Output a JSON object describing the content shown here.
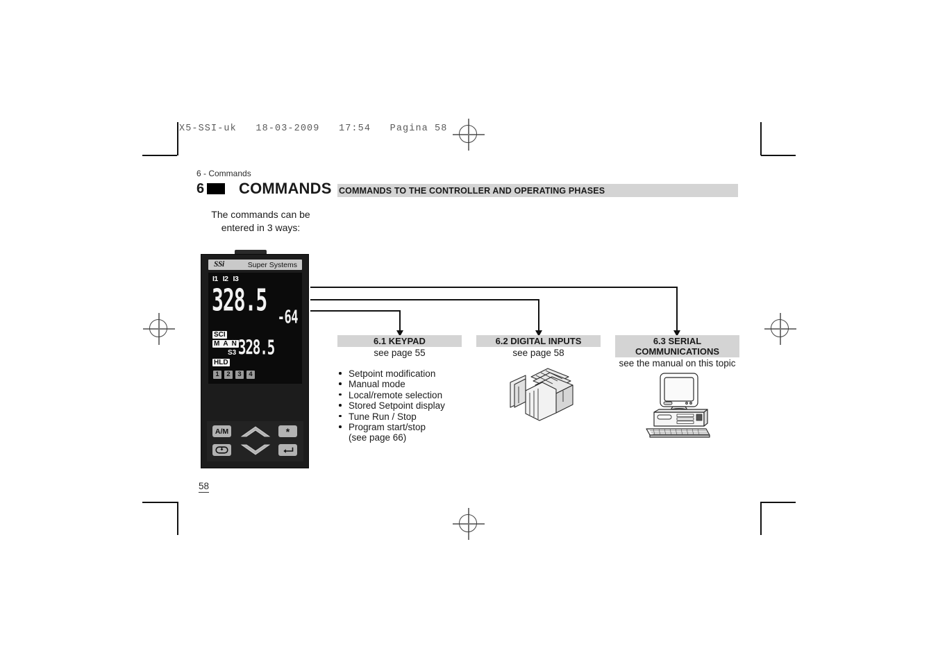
{
  "print_marks": {
    "file_banner": "X5-SSI-uk   18-03-2009   17:54   Pagina 58"
  },
  "header": {
    "running_head": "6 - Commands",
    "chapter_number": "6",
    "chapter_title": "COMMANDS",
    "banner_text": "COMMANDS TO THE CONTROLLER AND OPERATING PHASES"
  },
  "intro": {
    "text": "The commands can be entered in 3 ways:"
  },
  "device": {
    "brand_logo": "SSi",
    "brand_name": "Super Systems",
    "input_indicators": [
      "I1",
      "I2",
      "I3"
    ],
    "process_value": "328.5",
    "setpoint_value": "-64",
    "output_value": "328.5",
    "status_tags": {
      "sci": "SCI",
      "man": "M A N",
      "s3": "S3",
      "hld": "HLD"
    },
    "program_segments": [
      "1",
      "2",
      "3",
      "4"
    ],
    "keys": [
      {
        "name": "auto-manual-key",
        "label": "A/M"
      },
      {
        "name": "up-arrow-key",
        "label": ""
      },
      {
        "name": "star-key",
        "label": "*"
      },
      {
        "name": "loop-key",
        "label": ""
      },
      {
        "name": "down-arrow-key",
        "label": ""
      },
      {
        "name": "enter-key",
        "label": ""
      }
    ]
  },
  "columns": [
    {
      "id": "keypad",
      "heading": "6.1  KEYPAD",
      "subtext": "see page 55",
      "bullets": [
        "Setpoint modification",
        "Manual mode",
        "Local/remote selection",
        "Stored Setpoint display",
        "Tune Run / Stop",
        "Program start/stop",
        "(see page 66)"
      ]
    },
    {
      "id": "digital-inputs",
      "heading": "6.2  DIGITAL INPUTS",
      "subtext": "see page 58",
      "icon": "terminal-block-icon"
    },
    {
      "id": "serial-communications",
      "heading_line1": "6.3  SERIAL",
      "heading_line2": "COMMUNICATIONS",
      "subtext": "see the manual on this topic",
      "icon": "desktop-computer-icon"
    }
  ],
  "footer": {
    "page_number": "58"
  },
  "colors": {
    "banner_gray": "#d4d4d4",
    "device_body": "#1c1c1c",
    "lcd_background": "#0b0b0b",
    "lcd_digit": "#f2f2f2",
    "key_face": "#b2b2b2",
    "rule_black": "#111111"
  }
}
